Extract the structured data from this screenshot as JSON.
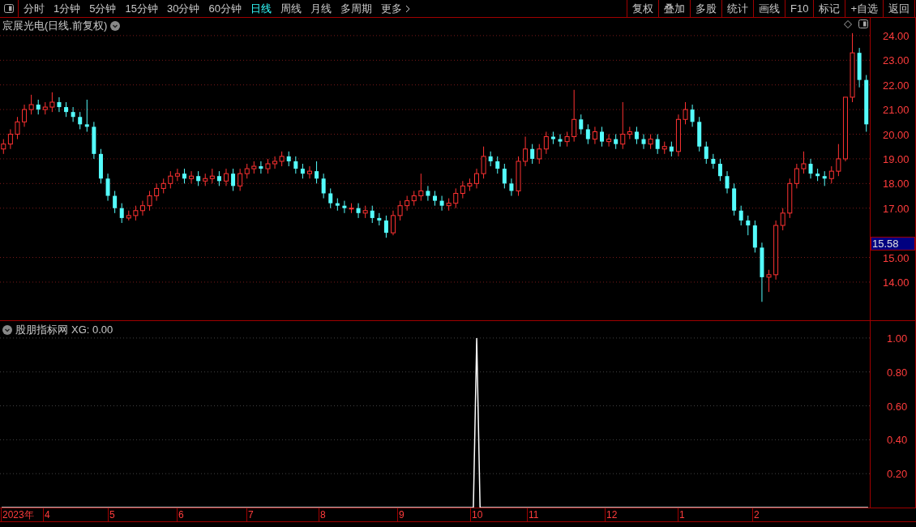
{
  "toolbar": {
    "periods": [
      {
        "label": "分时",
        "selected": false
      },
      {
        "label": "1分钟",
        "selected": false
      },
      {
        "label": "5分钟",
        "selected": false
      },
      {
        "label": "15分钟",
        "selected": false
      },
      {
        "label": "30分钟",
        "selected": false
      },
      {
        "label": "60分钟",
        "selected": false
      },
      {
        "label": "日线",
        "selected": true
      },
      {
        "label": "周线",
        "selected": false
      },
      {
        "label": "月线",
        "selected": false
      },
      {
        "label": "多周期",
        "selected": false
      }
    ],
    "more": "更多",
    "buttons": [
      "复权",
      "叠加",
      "多股",
      "统计",
      "画线",
      "F10",
      "标记",
      "+自选",
      "返回"
    ]
  },
  "price_panel": {
    "title": "宸展光电(日线.前复权)",
    "last_price": "15.58",
    "chart_data": {
      "type": "candlestick",
      "grid": true,
      "ylim": [
        12.42,
        24.72
      ],
      "yticks": [
        {
          "value": 24,
          "label": "24.00"
        },
        {
          "value": 23,
          "label": "23.00"
        },
        {
          "value": 22,
          "label": "22.00"
        },
        {
          "value": 21,
          "label": "21.00"
        },
        {
          "value": 20,
          "label": "20.00"
        },
        {
          "value": 19,
          "label": "19.00"
        },
        {
          "value": 18,
          "label": "18.00"
        },
        {
          "value": 17,
          "label": "17.00"
        },
        {
          "value": 15,
          "label": "15.00"
        },
        {
          "value": 14,
          "label": "14.00"
        }
      ],
      "ohlc": [
        [
          19.4,
          19.8,
          19.2,
          19.6
        ],
        [
          19.6,
          20.2,
          19.4,
          20.0
        ],
        [
          20.0,
          20.7,
          19.8,
          20.5
        ],
        [
          20.5,
          21.2,
          20.3,
          21.0
        ],
        [
          21.0,
          21.6,
          20.8,
          21.2
        ],
        [
          21.2,
          21.4,
          20.8,
          21.0
        ],
        [
          21.0,
          21.3,
          20.8,
          21.1
        ],
        [
          21.1,
          21.7,
          20.9,
          21.3
        ],
        [
          21.3,
          21.5,
          20.9,
          21.1
        ],
        [
          21.1,
          21.3,
          20.7,
          20.9
        ],
        [
          20.9,
          21.1,
          20.5,
          20.7
        ],
        [
          20.7,
          20.9,
          20.2,
          20.4
        ],
        [
          20.4,
          21.4,
          20.1,
          20.3
        ],
        [
          20.3,
          20.5,
          19.0,
          19.2
        ],
        [
          19.2,
          19.4,
          18.0,
          18.2
        ],
        [
          18.2,
          18.4,
          17.3,
          17.5
        ],
        [
          17.5,
          17.7,
          16.8,
          17.0
        ],
        [
          17.0,
          17.2,
          16.4,
          16.6
        ],
        [
          16.6,
          16.9,
          16.5,
          16.7
        ],
        [
          16.7,
          17.1,
          16.5,
          16.9
        ],
        [
          16.9,
          17.3,
          16.7,
          17.1
        ],
        [
          17.1,
          17.7,
          16.9,
          17.5
        ],
        [
          17.5,
          18.0,
          17.3,
          17.8
        ],
        [
          17.8,
          18.2,
          17.6,
          18.0
        ],
        [
          18.0,
          18.5,
          17.8,
          18.3
        ],
        [
          18.3,
          18.6,
          18.1,
          18.4
        ],
        [
          18.4,
          18.6,
          18.0,
          18.2
        ],
        [
          18.2,
          18.5,
          18.0,
          18.3
        ],
        [
          18.3,
          18.5,
          17.9,
          18.1
        ],
        [
          18.1,
          18.4,
          17.9,
          18.2
        ],
        [
          18.2,
          18.6,
          18.0,
          18.3
        ],
        [
          18.3,
          18.5,
          17.9,
          18.1
        ],
        [
          18.1,
          18.6,
          17.9,
          18.4
        ],
        [
          18.4,
          18.6,
          17.7,
          17.9
        ],
        [
          17.9,
          18.6,
          17.7,
          18.4
        ],
        [
          18.4,
          18.8,
          18.2,
          18.6
        ],
        [
          18.6,
          18.9,
          18.4,
          18.7
        ],
        [
          18.7,
          18.9,
          18.4,
          18.6
        ],
        [
          18.6,
          19.0,
          18.4,
          18.8
        ],
        [
          18.8,
          19.1,
          18.6,
          18.9
        ],
        [
          18.9,
          19.3,
          18.7,
          19.1
        ],
        [
          19.1,
          19.3,
          18.7,
          18.9
        ],
        [
          18.9,
          19.1,
          18.4,
          18.6
        ],
        [
          18.6,
          18.8,
          18.2,
          18.4
        ],
        [
          18.4,
          18.7,
          18.2,
          18.5
        ],
        [
          18.5,
          18.9,
          18.0,
          18.2
        ],
        [
          18.2,
          18.4,
          17.4,
          17.6
        ],
        [
          17.6,
          17.8,
          17.0,
          17.2
        ],
        [
          17.2,
          17.4,
          16.9,
          17.1
        ],
        [
          17.1,
          17.3,
          16.8,
          17.0
        ],
        [
          17.0,
          17.2,
          16.8,
          17.0
        ],
        [
          17.0,
          17.2,
          16.6,
          16.8
        ],
        [
          16.8,
          17.1,
          16.6,
          16.9
        ],
        [
          16.9,
          17.1,
          16.4,
          16.6
        ],
        [
          16.6,
          16.8,
          16.3,
          16.5
        ],
        [
          16.5,
          16.7,
          15.8,
          16.0
        ],
        [
          16.0,
          16.9,
          15.9,
          16.7
        ],
        [
          16.7,
          17.3,
          16.5,
          17.1
        ],
        [
          17.1,
          17.5,
          16.9,
          17.3
        ],
        [
          17.3,
          17.7,
          17.1,
          17.5
        ],
        [
          17.5,
          18.4,
          17.3,
          17.7
        ],
        [
          17.7,
          17.9,
          17.3,
          17.5
        ],
        [
          17.5,
          17.7,
          17.1,
          17.3
        ],
        [
          17.3,
          17.5,
          16.9,
          17.1
        ],
        [
          17.1,
          17.4,
          16.9,
          17.2
        ],
        [
          17.2,
          17.8,
          17.0,
          17.6
        ],
        [
          17.6,
          18.1,
          17.4,
          17.9
        ],
        [
          17.9,
          18.2,
          17.7,
          18.0
        ],
        [
          18.0,
          18.6,
          17.8,
          18.4
        ],
        [
          18.4,
          19.5,
          18.2,
          19.1
        ],
        [
          19.1,
          19.3,
          18.7,
          18.9
        ],
        [
          18.9,
          19.1,
          18.4,
          18.6
        ],
        [
          18.6,
          18.8,
          17.8,
          18.0
        ],
        [
          18.0,
          18.2,
          17.5,
          17.7
        ],
        [
          17.7,
          19.1,
          17.5,
          18.9
        ],
        [
          18.9,
          19.9,
          18.7,
          19.4
        ],
        [
          19.4,
          19.6,
          18.8,
          19.0
        ],
        [
          19.0,
          19.6,
          18.8,
          19.4
        ],
        [
          19.4,
          20.1,
          19.2,
          19.9
        ],
        [
          19.9,
          20.1,
          19.6,
          19.8
        ],
        [
          19.8,
          20.0,
          19.5,
          19.7
        ],
        [
          19.7,
          20.1,
          19.5,
          19.9
        ],
        [
          19.9,
          21.8,
          19.7,
          20.6
        ],
        [
          20.6,
          20.8,
          20.0,
          20.2
        ],
        [
          20.2,
          20.4,
          19.6,
          19.8
        ],
        [
          19.8,
          20.3,
          19.6,
          20.1
        ],
        [
          20.1,
          20.3,
          19.5,
          19.7
        ],
        [
          19.7,
          20.0,
          19.5,
          19.8
        ],
        [
          19.8,
          20.0,
          19.4,
          19.6
        ],
        [
          19.6,
          21.3,
          19.4,
          20.0
        ],
        [
          20.0,
          20.3,
          19.8,
          20.1
        ],
        [
          20.1,
          20.3,
          19.6,
          19.8
        ],
        [
          19.8,
          20.0,
          19.4,
          19.6
        ],
        [
          19.6,
          20.0,
          19.4,
          19.8
        ],
        [
          19.8,
          20.0,
          19.2,
          19.4
        ],
        [
          19.4,
          19.7,
          19.2,
          19.5
        ],
        [
          19.5,
          19.7,
          19.1,
          19.3
        ],
        [
          19.3,
          20.8,
          19.1,
          20.6
        ],
        [
          20.6,
          21.3,
          20.4,
          21.0
        ],
        [
          21.0,
          21.2,
          20.3,
          20.5
        ],
        [
          20.5,
          20.7,
          19.3,
          19.5
        ],
        [
          19.5,
          19.7,
          18.8,
          19.0
        ],
        [
          19.0,
          19.2,
          18.6,
          18.8
        ],
        [
          18.8,
          19.0,
          18.1,
          18.3
        ],
        [
          18.3,
          18.5,
          17.6,
          17.8
        ],
        [
          17.8,
          18.0,
          16.7,
          16.9
        ],
        [
          16.9,
          17.1,
          16.3,
          16.5
        ],
        [
          16.5,
          16.7,
          15.9,
          16.3
        ],
        [
          16.3,
          16.5,
          15.2,
          15.4
        ],
        [
          15.4,
          15.6,
          13.2,
          14.2
        ],
        [
          14.2,
          14.5,
          13.6,
          14.3
        ],
        [
          14.3,
          16.5,
          14.1,
          16.3
        ],
        [
          16.3,
          17.0,
          16.1,
          16.8
        ],
        [
          16.8,
          18.2,
          16.6,
          18.0
        ],
        [
          18.0,
          18.8,
          17.8,
          18.6
        ],
        [
          18.6,
          19.3,
          18.4,
          18.8
        ],
        [
          18.8,
          19.0,
          18.2,
          18.4
        ],
        [
          18.4,
          18.6,
          18.1,
          18.3
        ],
        [
          18.3,
          18.5,
          17.9,
          18.2
        ],
        [
          18.2,
          18.7,
          18.0,
          18.5
        ],
        [
          18.5,
          19.6,
          18.3,
          19.0
        ],
        [
          19.0,
          21.5,
          18.9,
          21.5
        ],
        [
          21.5,
          24.1,
          21.3,
          23.3
        ],
        [
          23.3,
          23.5,
          21.9,
          22.2
        ],
        [
          22.2,
          22.4,
          20.1,
          20.4
        ]
      ]
    }
  },
  "indicator_panel": {
    "title": "股朋指标网",
    "reading": "XG: 0.00",
    "chart_data": {
      "type": "line",
      "grid": true,
      "ylim": [
        0,
        1.1
      ],
      "yticks": [
        {
          "value": 0.2,
          "label": "0.20"
        },
        {
          "value": 0.4,
          "label": "0.40"
        },
        {
          "value": 0.6,
          "label": "0.60"
        },
        {
          "value": 0.8,
          "label": "0.80"
        },
        {
          "value": 1,
          "label": "1.00"
        }
      ],
      "series": [
        {
          "color": "#ffffff",
          "values": [
            0,
            0,
            0,
            0,
            0,
            0,
            0,
            0,
            0,
            0,
            0,
            0,
            0,
            0,
            0,
            0,
            0,
            0,
            0,
            0,
            0,
            0,
            0,
            0,
            0,
            0,
            0,
            0,
            0,
            0,
            0,
            0,
            0,
            0,
            0,
            0,
            0,
            0,
            0,
            0,
            0,
            0,
            0,
            0,
            0,
            0,
            0,
            0,
            0,
            0,
            0,
            0,
            0,
            0,
            0,
            0,
            0,
            0,
            0,
            0,
            0,
            0,
            0,
            0,
            0,
            0,
            0,
            0,
            0,
            0,
            0,
            0,
            0,
            0,
            0,
            0,
            0,
            0,
            0,
            0,
            0,
            0,
            0,
            0,
            0,
            0,
            0,
            0,
            0,
            0,
            0,
            0,
            0,
            0,
            0,
            0,
            0,
            0,
            0,
            0,
            0,
            0,
            0,
            0,
            0,
            0,
            0,
            0,
            0,
            0,
            0,
            0,
            0,
            0,
            0,
            0,
            0,
            0,
            0,
            0,
            0,
            0,
            0,
            0,
            0,
            0,
            0,
            0,
            0,
            0,
            0,
            0,
            0,
            0,
            0,
            0,
            0,
            0,
            0,
            0,
            0,
            0,
            1,
            0,
            0,
            0,
            0,
            0,
            0,
            0,
            0,
            0,
            0,
            0,
            0,
            0,
            0,
            0,
            0,
            0,
            0,
            0,
            0,
            0,
            0,
            0,
            0,
            0,
            0,
            0,
            0,
            0,
            0,
            0,
            0,
            0,
            0,
            0,
            0,
            0,
            0,
            0,
            0,
            0,
            0,
            0,
            0,
            0,
            0,
            0,
            0,
            0,
            0,
            0,
            0,
            0,
            0,
            0,
            0,
            0,
            0,
            0,
            0,
            0,
            0,
            0,
            0,
            0,
            0,
            0,
            0,
            0,
            0,
            0,
            0,
            0,
            0,
            0,
            0,
            0,
            0,
            0,
            0,
            0,
            0,
            0,
            0,
            0,
            0,
            0,
            0,
            0,
            0,
            0,
            0,
            0,
            0,
            0,
            0,
            0,
            0,
            0,
            0,
            0,
            0,
            0,
            0,
            0,
            0,
            0,
            0,
            0,
            0,
            0,
            0,
            0,
            0,
            0,
            0,
            0
          ]
        }
      ]
    }
  },
  "time_axis": [
    "2023年",
    "4",
    "5",
    "6",
    "7",
    "8",
    "9",
    "10",
    "11",
    "12",
    "1",
    "2"
  ]
}
